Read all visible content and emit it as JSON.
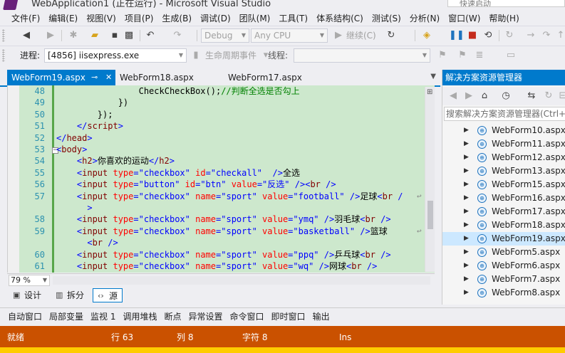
{
  "window": {
    "title": "WebApplication1 (正在运行) - Microsoft Visual Studio",
    "quick_launch": "快速启动"
  },
  "menu": [
    "文件(F)",
    "编辑(E)",
    "视图(V)",
    "项目(P)",
    "生成(B)",
    "调试(D)",
    "团队(M)",
    "工具(T)",
    "体系结构(C)",
    "测试(S)",
    "分析(N)",
    "窗口(W)",
    "帮助(H)"
  ],
  "toolbar1": {
    "config": "Debug",
    "platform": "Any CPU",
    "continue": "继续(C)"
  },
  "toolbar2": {
    "process_label": "进程:",
    "process_value": "[4856] iisexpress.exe",
    "lifecycle": "生命周期事件",
    "thread_label": "线程:"
  },
  "tabs": [
    "WebForm19.aspx",
    "WebForm18.aspx",
    "WebForm17.aspx"
  ],
  "tab_icons": {
    "pin": "⊸",
    "close": "✕"
  },
  "code_lines": [
    {
      "num": "48",
      "tokens": [
        [
          "x",
          "                CheckCheckBox();"
        ],
        [
          "c",
          "//判断全选是否勾上"
        ]
      ]
    },
    {
      "num": "49",
      "tokens": [
        [
          "x",
          "            })"
        ]
      ]
    },
    {
      "num": "50",
      "tokens": [
        [
          "x",
          "        });"
        ]
      ]
    },
    {
      "num": "51",
      "tokens": [
        [
          "b",
          "    </"
        ],
        [
          "t",
          "script"
        ],
        [
          "b",
          ">"
        ]
      ]
    },
    {
      "num": "52",
      "tokens": [
        [
          "b",
          "</"
        ],
        [
          "t",
          "head"
        ],
        [
          "b",
          ">"
        ]
      ]
    },
    {
      "num": "53",
      "tokens": [
        [
          "b",
          "<"
        ],
        [
          "t",
          "body"
        ],
        [
          "b",
          ">"
        ]
      ]
    },
    {
      "num": "54",
      "tokens": [
        [
          "b",
          "    <"
        ],
        [
          "t",
          "h2"
        ],
        [
          "b",
          ">"
        ],
        [
          "x",
          "你喜欢的运动"
        ],
        [
          "b",
          "</"
        ],
        [
          "t",
          "h2"
        ],
        [
          "b",
          ">"
        ]
      ]
    },
    {
      "num": "55",
      "tokens": [
        [
          "b",
          "    <"
        ],
        [
          "t",
          "input"
        ],
        [
          "x",
          " "
        ],
        [
          "a",
          "type"
        ],
        [
          "b",
          "=\"checkbox\""
        ],
        [
          "x",
          " "
        ],
        [
          "a",
          "id"
        ],
        [
          "b",
          "=\"checkall\""
        ],
        [
          "x",
          "  "
        ],
        [
          "b",
          "/>"
        ],
        [
          "x",
          "全选"
        ]
      ]
    },
    {
      "num": "56",
      "tokens": [
        [
          "b",
          "    <"
        ],
        [
          "t",
          "input"
        ],
        [
          "x",
          " "
        ],
        [
          "a",
          "type"
        ],
        [
          "b",
          "=\"button\""
        ],
        [
          "x",
          " "
        ],
        [
          "a",
          "id"
        ],
        [
          "b",
          "=\"btn\""
        ],
        [
          "x",
          " "
        ],
        [
          "a",
          "value"
        ],
        [
          "b",
          "=\"反选\""
        ],
        [
          "x",
          " "
        ],
        [
          "b",
          "/><"
        ],
        [
          "t",
          "br"
        ],
        [
          "x",
          " "
        ],
        [
          "b",
          "/>"
        ]
      ]
    },
    {
      "num": "57",
      "tokens": [
        [
          "b",
          "    <"
        ],
        [
          "t",
          "input"
        ],
        [
          "x",
          " "
        ],
        [
          "a",
          "type"
        ],
        [
          "b",
          "=\"checkbox\""
        ],
        [
          "x",
          " "
        ],
        [
          "a",
          "name"
        ],
        [
          "b",
          "=\"sport\""
        ],
        [
          "x",
          " "
        ],
        [
          "a",
          "value"
        ],
        [
          "b",
          "=\"football\""
        ],
        [
          "x",
          " "
        ],
        [
          "b",
          "/>"
        ],
        [
          "x",
          "足球"
        ],
        [
          "b",
          "<"
        ],
        [
          "t",
          "br"
        ],
        [
          "x",
          " "
        ],
        [
          "b",
          "/"
        ]
      ],
      "wrapped": true
    },
    {
      "num": "",
      "tokens": [
        [
          "b",
          "      >"
        ]
      ]
    },
    {
      "num": "58",
      "tokens": [
        [
          "b",
          "    <"
        ],
        [
          "t",
          "input"
        ],
        [
          "x",
          " "
        ],
        [
          "a",
          "type"
        ],
        [
          "b",
          "=\"checkbox\""
        ],
        [
          "x",
          " "
        ],
        [
          "a",
          "name"
        ],
        [
          "b",
          "=\"sport\""
        ],
        [
          "x",
          " "
        ],
        [
          "a",
          "value"
        ],
        [
          "b",
          "=\"ymq\""
        ],
        [
          "x",
          " "
        ],
        [
          "b",
          "/>"
        ],
        [
          "x",
          "羽毛球"
        ],
        [
          "b",
          "<"
        ],
        [
          "t",
          "br"
        ],
        [
          "x",
          " "
        ],
        [
          "b",
          "/>"
        ]
      ]
    },
    {
      "num": "59",
      "tokens": [
        [
          "b",
          "    <"
        ],
        [
          "t",
          "input"
        ],
        [
          "x",
          " "
        ],
        [
          "a",
          "type"
        ],
        [
          "b",
          "=\"checkbox\""
        ],
        [
          "x",
          " "
        ],
        [
          "a",
          "name"
        ],
        [
          "b",
          "=\"sport\""
        ],
        [
          "x",
          " "
        ],
        [
          "a",
          "value"
        ],
        [
          "b",
          "=\"basketball\""
        ],
        [
          "x",
          " "
        ],
        [
          "b",
          "/>"
        ],
        [
          "x",
          "篮球"
        ]
      ],
      "wrapped": true
    },
    {
      "num": "",
      "tokens": [
        [
          "b",
          "      <"
        ],
        [
          "t",
          "br"
        ],
        [
          "x",
          " "
        ],
        [
          "b",
          "/>"
        ]
      ]
    },
    {
      "num": "60",
      "tokens": [
        [
          "b",
          "    <"
        ],
        [
          "t",
          "input"
        ],
        [
          "x",
          " "
        ],
        [
          "a",
          "type"
        ],
        [
          "b",
          "=\"checkbox\""
        ],
        [
          "x",
          " "
        ],
        [
          "a",
          "name"
        ],
        [
          "b",
          "=\"sport\""
        ],
        [
          "x",
          " "
        ],
        [
          "a",
          "value"
        ],
        [
          "b",
          "=\"ppq\""
        ],
        [
          "x",
          " "
        ],
        [
          "b",
          "/>"
        ],
        [
          "x",
          "乒乓球"
        ],
        [
          "b",
          "<"
        ],
        [
          "t",
          "br"
        ],
        [
          "x",
          " "
        ],
        [
          "b",
          "/>"
        ]
      ]
    },
    {
      "num": "61",
      "tokens": [
        [
          "b",
          "    <"
        ],
        [
          "t",
          "input"
        ],
        [
          "x",
          " "
        ],
        [
          "a",
          "type"
        ],
        [
          "b",
          "=\"checkbox\""
        ],
        [
          "x",
          " "
        ],
        [
          "a",
          "name"
        ],
        [
          "b",
          "=\"sport\""
        ],
        [
          "x",
          " "
        ],
        [
          "a",
          "value"
        ],
        [
          "b",
          "=\"wq\""
        ],
        [
          "x",
          " "
        ],
        [
          "b",
          "/>"
        ],
        [
          "x",
          "网球"
        ],
        [
          "b",
          "<"
        ],
        [
          "t",
          "br"
        ],
        [
          "x",
          " "
        ],
        [
          "b",
          "/>"
        ]
      ]
    }
  ],
  "wrap_glyph": "↩",
  "zoom": "79 %",
  "views": [
    "设计",
    "拆分",
    "源"
  ],
  "view_icons": [
    "▣",
    "▥",
    "‹›"
  ],
  "solution_explorer": {
    "title": "解决方案资源管理器",
    "search_placeholder": "搜索解决方案资源管理器(Ctrl+;)",
    "items": [
      "WebForm10.aspx",
      "WebForm11.aspx",
      "WebForm12.aspx",
      "WebForm13.aspx",
      "WebForm15.aspx",
      "WebForm16.aspx",
      "WebForm17.aspx",
      "WebForm18.aspx",
      "WebForm19.aspx",
      "WebForm5.aspx",
      "WebForm6.aspx",
      "WebForm7.aspx",
      "WebForm8.aspx"
    ],
    "selected": "WebForm19.aspx"
  },
  "bottom_tabs": [
    "自动窗口",
    "局部变量",
    "监视 1",
    "调用堆栈",
    "断点",
    "异常设置",
    "命令窗口",
    "即时窗口",
    "输出"
  ],
  "status": {
    "ready": "就绪",
    "line": "行 63",
    "col": "列 8",
    "char": "字符 8",
    "mode": "Ins"
  },
  "colors": {
    "accent": "#007acc",
    "status_bar": "#ca5100",
    "code_bg": "#cde8cd"
  }
}
